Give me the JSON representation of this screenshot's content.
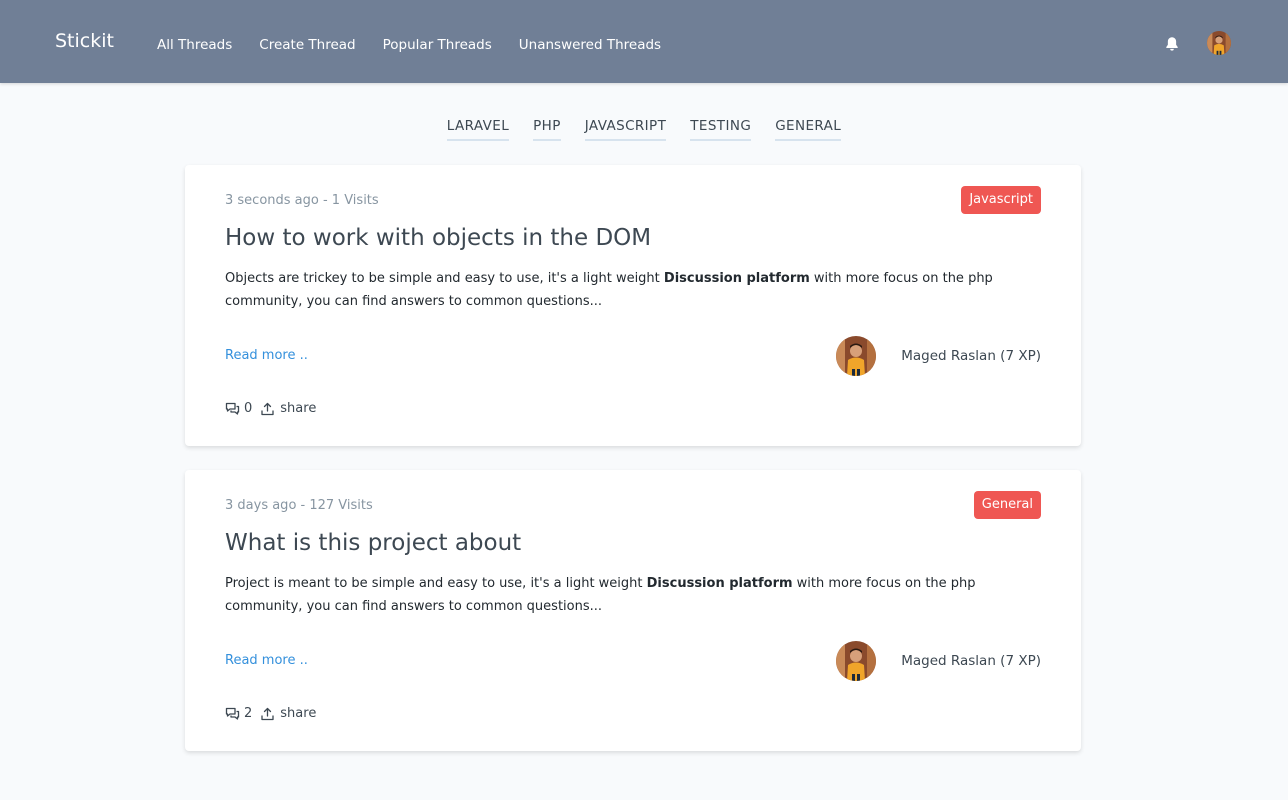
{
  "navbar": {
    "brand": "Stickit",
    "links": [
      "All Threads",
      "Create Thread",
      "Popular Threads",
      "Unanswered Threads"
    ],
    "icons": [
      "bell-icon",
      "user-avatar"
    ]
  },
  "channels": [
    "LARAVEL",
    "PHP",
    "JAVASCRIPT",
    "TESTING",
    "GENERAL"
  ],
  "threads": [
    {
      "meta": "3 seconds ago - 1 Visits",
      "tag": "Javascript",
      "title": "How to work with objects in the DOM",
      "excerpt_start": "Objects are trickey to be simple and easy to use, it's a light weight ",
      "excerpt_bold": "Discussion platform",
      "excerpt_end": " with more focus on the php community, you can find answers to common questions...",
      "read_more": "Read more ..",
      "author": "Maged Raslan (7 XP)",
      "replies": "0",
      "share": "share"
    },
    {
      "meta": "3 days ago - 127 Visits",
      "tag": "General",
      "title": "What is this project about",
      "excerpt_start": "Project is meant to be simple and easy to use, it's a light weight ",
      "excerpt_bold": "Discussion platform",
      "excerpt_end": " with more focus on the php community, you can find answers to common questions...",
      "read_more": "Read more ..",
      "author": "Maged Raslan (7 XP)",
      "replies": "2",
      "share": "share"
    }
  ],
  "colors": {
    "navbar": "#707f96",
    "background": "#f8fafc",
    "tag": "#ef5753",
    "link": "#3490dc"
  }
}
